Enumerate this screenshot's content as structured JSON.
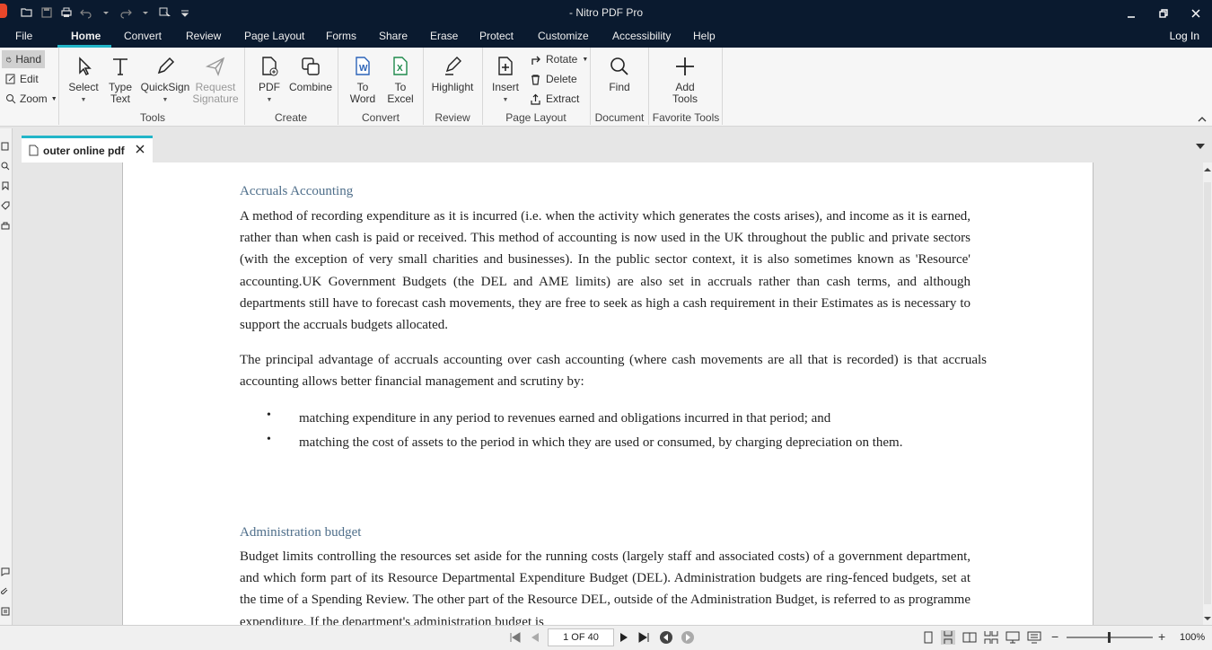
{
  "app": {
    "title": "- Nitro PDF Pro"
  },
  "menu": {
    "tabs": [
      "File",
      "Home",
      "Convert",
      "Review",
      "Page Layout",
      "Forms",
      "Share",
      "Erase",
      "Protect",
      "Customize",
      "Accessibility",
      "Help"
    ],
    "active": "Home",
    "login": "Log In"
  },
  "ribbon": {
    "left": {
      "hand": "Hand",
      "edit": "Edit",
      "zoom": "Zoom"
    },
    "tools": {
      "select": "Select",
      "type_text_1": "Type",
      "type_text_2": "Text",
      "quicksign": "QuickSign",
      "request_1": "Request",
      "request_2": "Signature",
      "group": "Tools"
    },
    "create": {
      "pdf": "PDF",
      "combine": "Combine",
      "group": "Create"
    },
    "convert": {
      "word_1": "To",
      "word_2": "Word",
      "excel_1": "To",
      "excel_2": "Excel",
      "group": "Convert"
    },
    "review": {
      "highlight": "Highlight",
      "group": "Review"
    },
    "page_layout": {
      "insert": "Insert",
      "rotate": "Rotate",
      "delete": "Delete",
      "extract": "Extract",
      "group": "Page Layout"
    },
    "document": {
      "find": "Find",
      "group": "Document"
    },
    "favorites": {
      "add_1": "Add",
      "add_2": "Tools",
      "group": "Favorite Tools"
    }
  },
  "document_tab": {
    "name": "outer online pdf"
  },
  "content": {
    "heading1": "Accruals Accounting",
    "para1": "A method of recording expenditure as it is incurred (i.e. when the activity which generates the costs arises), and income as it is earned, rather than when cash is paid or received. This method of accounting is now used in the UK throughout the public and private sectors (with the exception of very small charities and businesses). In the public sector context, it is also sometimes known as 'Resource' accounting.UK Government Budgets (the DEL and AME limits) are also set in accruals rather than cash terms, and although departments still have to forecast cash movements, they are free to seek as high a cash requirement in their Estimates as is necessary to support the accruals budgets allocated.",
    "para2": "The principal advantage of accruals accounting over cash accounting (where cash movements are all that is recorded) is that accruals accounting allows better financial  management and scrutiny by:",
    "bullet_char": "•",
    "bullet1": "matching expenditure in any period to revenues earned and obligations incurred in that period; and",
    "bullet2": "matching the cost of assets to the period in which they are used or consumed, by charging depreciation on them.",
    "heading2": "Administration  budget",
    "para3": "Budget limits controlling the resources set aside for the running costs (largely staff and associated costs) of a government department, and which form part of its Resource Departmental Expenditure Budget (DEL). Administration budgets are ring-fenced budgets, set at the time of a Spending Review. The other part of the Resource DEL, outside of the Administration Budget, is referred to as programme expenditure. If the department's administration budget is"
  },
  "status": {
    "page_indicator": "1 OF 40",
    "zoom": "100%",
    "zoom_minus": "−",
    "zoom_plus": "+"
  },
  "colors": {
    "titlebar": "#0a1a2f",
    "accent": "#22b5c8",
    "heading": "#4e6e8a"
  }
}
